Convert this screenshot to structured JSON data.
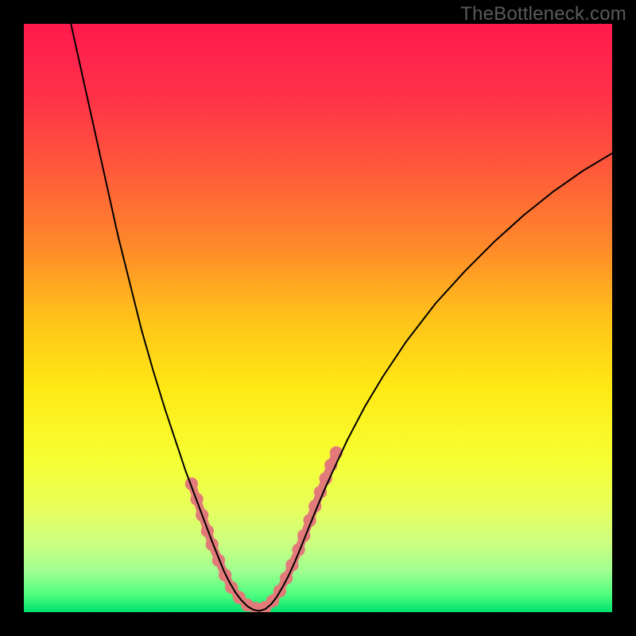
{
  "watermark": "TheBottleneck.com",
  "chart_data": {
    "type": "line",
    "title": "",
    "xlabel": "",
    "ylabel": "",
    "xlim": [
      0,
      100
    ],
    "ylim": [
      0,
      100
    ],
    "background_gradient": {
      "stops": [
        {
          "offset": 0.0,
          "color": "#ff1a4d"
        },
        {
          "offset": 0.12,
          "color": "#ff3049"
        },
        {
          "offset": 0.25,
          "color": "#ff5a3a"
        },
        {
          "offset": 0.38,
          "color": "#ff8a2a"
        },
        {
          "offset": 0.5,
          "color": "#ffc21a"
        },
        {
          "offset": 0.62,
          "color": "#ffe915"
        },
        {
          "offset": 0.74,
          "color": "#f6ff33"
        },
        {
          "offset": 0.82,
          "color": "#e8ff5a"
        },
        {
          "offset": 0.88,
          "color": "#cfff80"
        },
        {
          "offset": 0.93,
          "color": "#a0ff90"
        },
        {
          "offset": 0.97,
          "color": "#50ff80"
        },
        {
          "offset": 1.0,
          "color": "#00e070"
        }
      ]
    },
    "series": [
      {
        "name": "bottleneck-curve",
        "color": "#000000",
        "stroke_width": 2,
        "points": [
          {
            "x": 8.0,
            "y": 100.0
          },
          {
            "x": 10.0,
            "y": 91.0
          },
          {
            "x": 12.0,
            "y": 82.0
          },
          {
            "x": 14.0,
            "y": 73.0
          },
          {
            "x": 16.0,
            "y": 64.0
          },
          {
            "x": 18.0,
            "y": 56.0
          },
          {
            "x": 20.0,
            "y": 48.0
          },
          {
            "x": 22.0,
            "y": 41.0
          },
          {
            "x": 24.0,
            "y": 34.5
          },
          {
            "x": 26.0,
            "y": 28.5
          },
          {
            "x": 27.5,
            "y": 24.0
          },
          {
            "x": 29.0,
            "y": 20.0
          },
          {
            "x": 30.5,
            "y": 16.0
          },
          {
            "x": 32.0,
            "y": 12.0
          },
          {
            "x": 33.0,
            "y": 9.5
          },
          {
            "x": 34.0,
            "y": 7.0
          },
          {
            "x": 35.0,
            "y": 5.0
          },
          {
            "x": 36.0,
            "y": 3.3
          },
          {
            "x": 37.0,
            "y": 2.0
          },
          {
            "x": 38.0,
            "y": 1.0
          },
          {
            "x": 39.0,
            "y": 0.4
          },
          {
            "x": 40.0,
            "y": 0.2
          },
          {
            "x": 41.0,
            "y": 0.5
          },
          {
            "x": 42.0,
            "y": 1.3
          },
          {
            "x": 43.0,
            "y": 2.6
          },
          {
            "x": 44.0,
            "y": 4.3
          },
          {
            "x": 45.0,
            "y": 6.2
          },
          {
            "x": 46.0,
            "y": 8.4
          },
          {
            "x": 47.0,
            "y": 10.8
          },
          {
            "x": 48.0,
            "y": 13.3
          },
          {
            "x": 49.5,
            "y": 17.0
          },
          {
            "x": 51.0,
            "y": 20.6
          },
          {
            "x": 53.0,
            "y": 25.0
          },
          {
            "x": 55.0,
            "y": 29.3
          },
          {
            "x": 58.0,
            "y": 35.0
          },
          {
            "x": 61.0,
            "y": 40.0
          },
          {
            "x": 65.0,
            "y": 46.0
          },
          {
            "x": 70.0,
            "y": 52.5
          },
          {
            "x": 75.0,
            "y": 58.0
          },
          {
            "x": 80.0,
            "y": 63.0
          },
          {
            "x": 85.0,
            "y": 67.5
          },
          {
            "x": 90.0,
            "y": 71.5
          },
          {
            "x": 95.0,
            "y": 75.0
          },
          {
            "x": 100.0,
            "y": 78.0
          }
        ]
      }
    ],
    "markers": {
      "name": "highlighted-points",
      "color": "#e27a7a",
      "radius_data_units": 1.1,
      "stem": {
        "width_data_units": 1.4,
        "color": "#e27a7a"
      },
      "points": [
        {
          "x": 28.5,
          "y": 21.8
        },
        {
          "x": 29.4,
          "y": 19.2
        },
        {
          "x": 30.3,
          "y": 16.5
        },
        {
          "x": 31.2,
          "y": 13.8
        },
        {
          "x": 32.0,
          "y": 11.5
        },
        {
          "x": 33.1,
          "y": 8.8
        },
        {
          "x": 34.2,
          "y": 6.3
        },
        {
          "x": 35.3,
          "y": 4.2
        },
        {
          "x": 36.6,
          "y": 2.5
        },
        {
          "x": 38.0,
          "y": 1.2
        },
        {
          "x": 39.5,
          "y": 0.6
        },
        {
          "x": 41.0,
          "y": 0.8
        },
        {
          "x": 42.3,
          "y": 1.9
        },
        {
          "x": 43.5,
          "y": 3.6
        },
        {
          "x": 44.6,
          "y": 5.8
        },
        {
          "x": 45.6,
          "y": 8.0
        },
        {
          "x": 46.7,
          "y": 10.6
        },
        {
          "x": 47.6,
          "y": 13.0
        },
        {
          "x": 48.6,
          "y": 15.6
        },
        {
          "x": 49.5,
          "y": 18.0
        },
        {
          "x": 50.4,
          "y": 20.4
        },
        {
          "x": 51.3,
          "y": 22.7
        },
        {
          "x": 52.2,
          "y": 25.0
        },
        {
          "x": 53.1,
          "y": 27.1
        }
      ]
    }
  }
}
